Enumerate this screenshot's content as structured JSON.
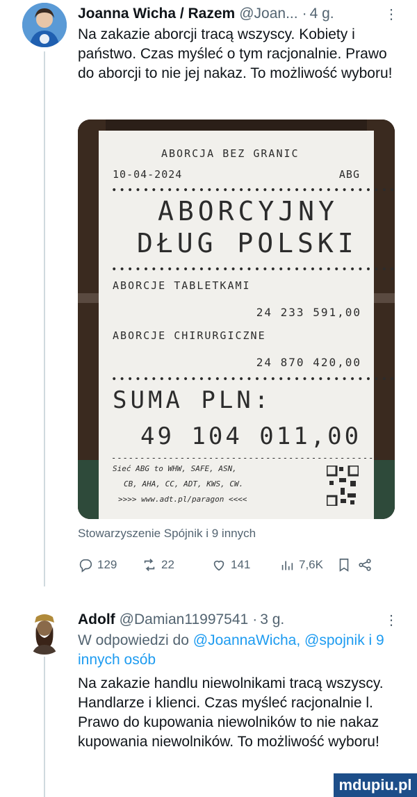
{
  "post1": {
    "name": "Joanna Wicha / Razem",
    "handle": "@Joan...",
    "dot": "·",
    "time": "4 g.",
    "more": "⋮",
    "text": "Na zakazie aborcji tracą wszyscy. Kobiety i państwo. Czas myśleć o tym racjonalnie. Prawo do aborcji to nie jej nakaz. To możliwość wyboru!",
    "image": {
      "line1": "ABORCJA BEZ GRANIC",
      "date": "10-04-2024",
      "code": "ABG",
      "title1": "ABORCYJNY",
      "title2": "DŁUG POLSKI",
      "item1": "ABORCJE TABLETKAMI",
      "item1_value": "24 233 591,00",
      "item2": "ABORCJE CHIRURGICZNE",
      "item2_value": "24 870 420,00",
      "sum_label": "SUMA PLN:",
      "sum_value": "49 104 011,00",
      "footer1": "Sieć ABG to WHW, SAFE, ASN,",
      "footer2": "CB, AHA, CC, ADT, KWS, CW.",
      "footer3": ">>>> www.adt.pl/paragon <<<<"
    },
    "attribution": "Stowarzyszenie Spójnik i 9 innych",
    "actions": {
      "replies": "129",
      "reposts": "22",
      "likes": "141",
      "views": "7,6K"
    }
  },
  "post2": {
    "name": "Adolf",
    "handle": "@Damian11997541",
    "dot": "·",
    "time": "3 g.",
    "more": "⋮",
    "reply_prefix": "W odpowiedzi do",
    "reply_to1": "@JoannaWicha,",
    "reply_to2": "@spojnik i 9 innych osób",
    "text": "Na zakazie handlu niewolnikami tracą wszyscy. Handlarze i klienci. Czas myśleć racjonalnie l. Prawo do kupowania niewolników to nie nakaz kupowania niewolników. To możliwość wyboru!"
  },
  "watermark": "mdupiu.pl",
  "colors": {
    "link": "#1d9bf0",
    "secondary": "#536471",
    "text": "#0f1419",
    "watermark_bg": "#1d4e89"
  },
  "icons": [
    "reply-icon",
    "repost-icon",
    "like-icon",
    "views-icon",
    "bookmark-icon",
    "share-icon"
  ]
}
